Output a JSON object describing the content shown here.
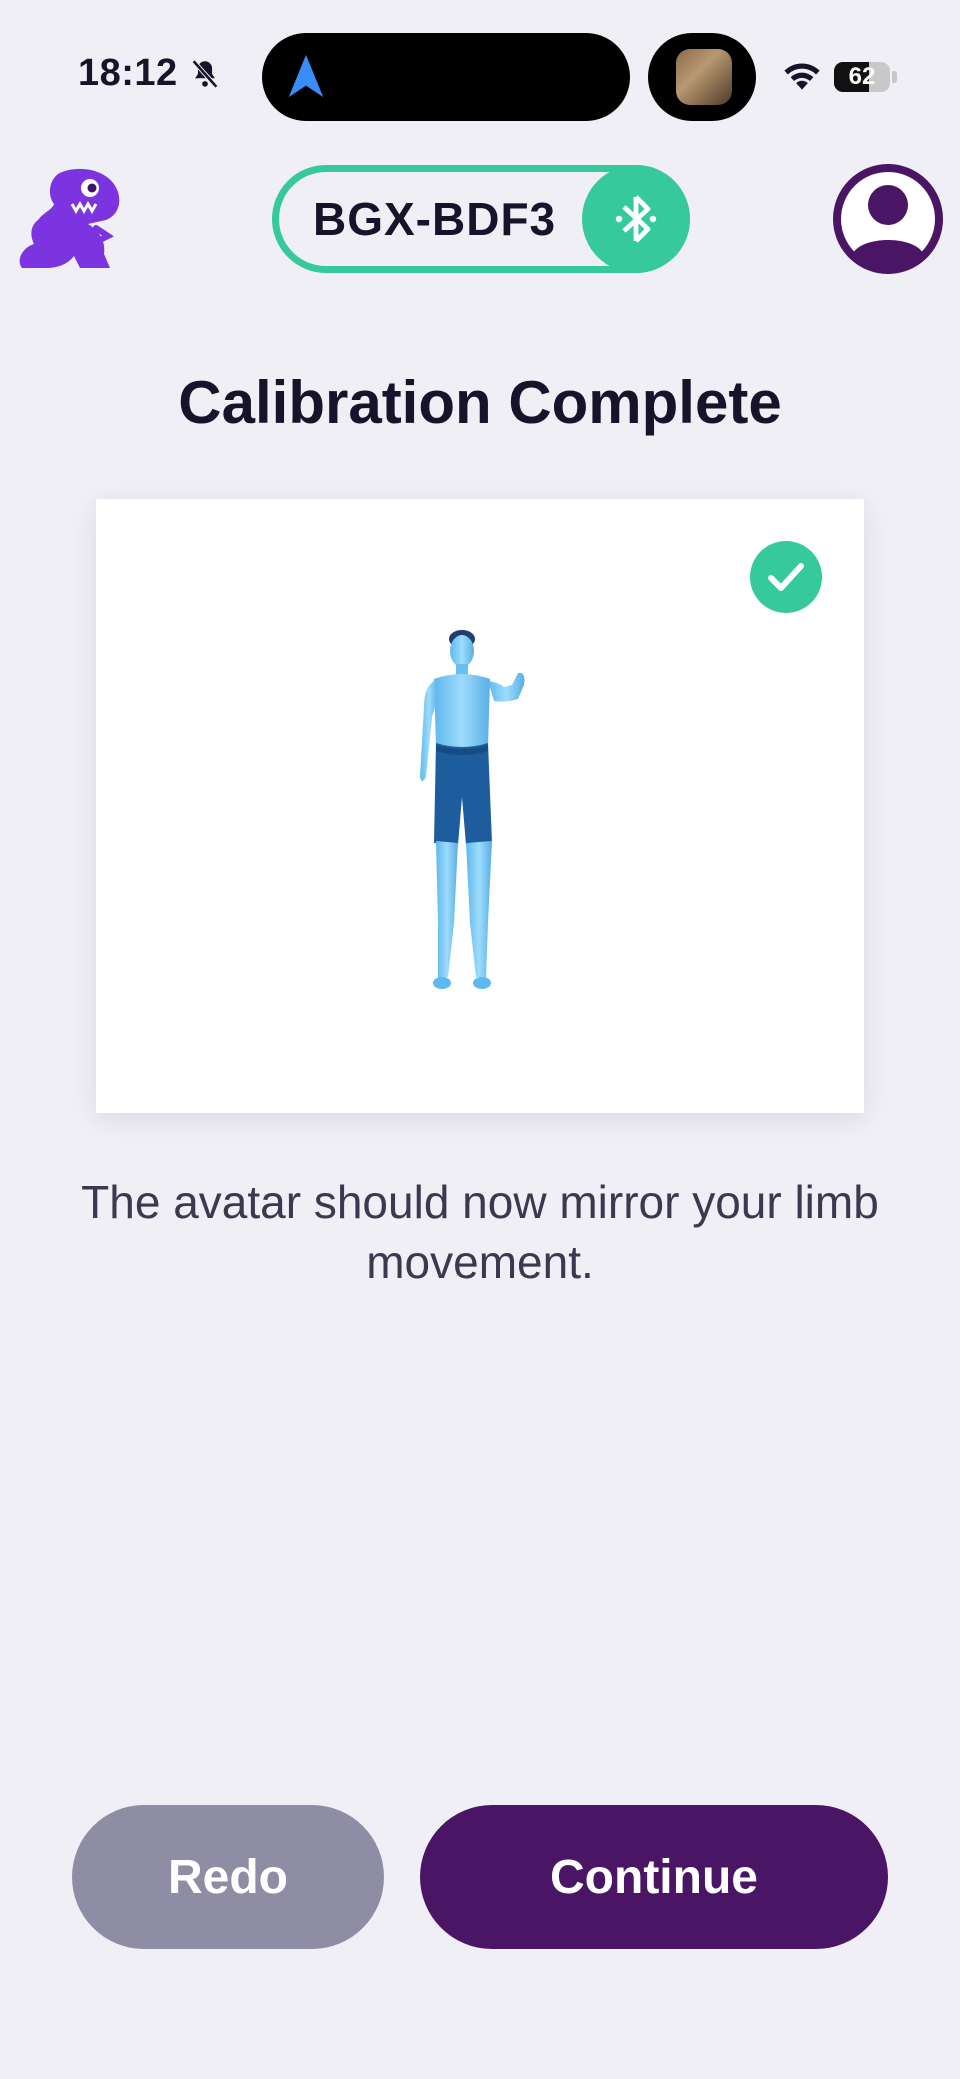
{
  "status_bar": {
    "time": "18:12",
    "battery": "62",
    "icons": [
      "bell-slash-icon",
      "location-arrow-icon",
      "now-playing-thumbnail",
      "wifi-icon",
      "battery-icon"
    ]
  },
  "header": {
    "logo_icon": "dino-logo-icon",
    "device_name": "BGX-BDF3",
    "bluetooth_icon": "bluetooth-icon",
    "profile_icon": "user-profile-icon"
  },
  "main": {
    "title": "Calibration Complete",
    "status_icon": "check-circle-icon",
    "avatar_icon": "avatar-figure",
    "description": "The avatar should now mirror your limb movement."
  },
  "actions": {
    "redo_label": "Redo",
    "continue_label": "Continue"
  },
  "colors": {
    "accent_green": "#35c99b",
    "brand_purple": "#4b1566",
    "logo_purple": "#7b34e0",
    "muted_gray": "#8f8da3",
    "background": "#f0eff5"
  }
}
